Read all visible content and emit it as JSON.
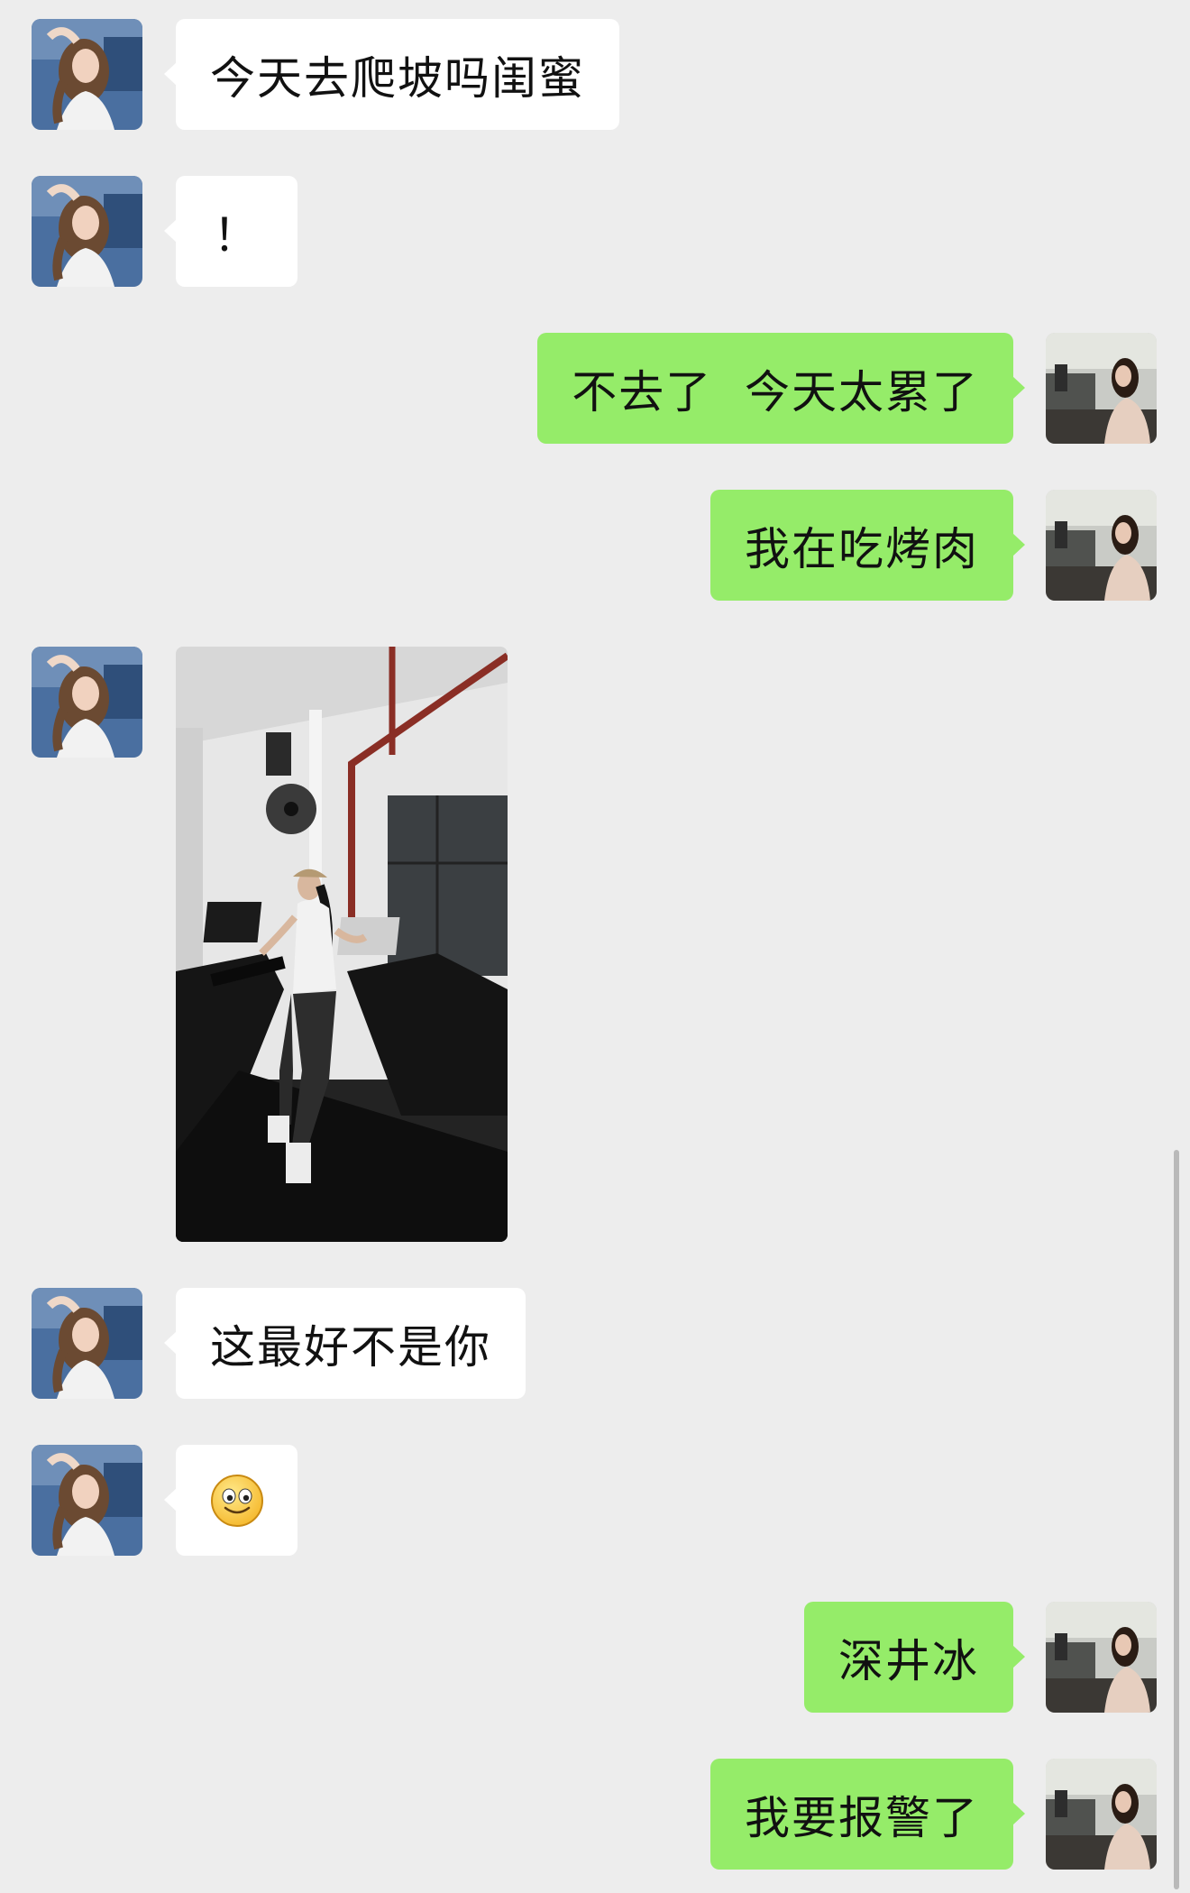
{
  "chat": {
    "messages": [
      {
        "sender": "friend",
        "type": "text",
        "text": "今天去爬坡吗闺蜜"
      },
      {
        "sender": "friend",
        "type": "text",
        "text": "！"
      },
      {
        "sender": "me",
        "type": "text",
        "text": "不去了  今天太累了"
      },
      {
        "sender": "me",
        "type": "text",
        "text": "我在吃烤肉"
      },
      {
        "sender": "friend",
        "type": "image",
        "description_icon": "photo-treadmill-gym"
      },
      {
        "sender": "friend",
        "type": "text",
        "text": "这最好不是你"
      },
      {
        "sender": "friend",
        "type": "emoji",
        "icon": "smile-emoji-icon"
      },
      {
        "sender": "me",
        "type": "text",
        "text": "深井冰"
      },
      {
        "sender": "me",
        "type": "text",
        "text": "我要报警了"
      }
    ]
  },
  "colors": {
    "background": "#ededed",
    "incoming_bubble": "#ffffff",
    "outgoing_bubble": "#95ec69",
    "text": "#111111"
  }
}
